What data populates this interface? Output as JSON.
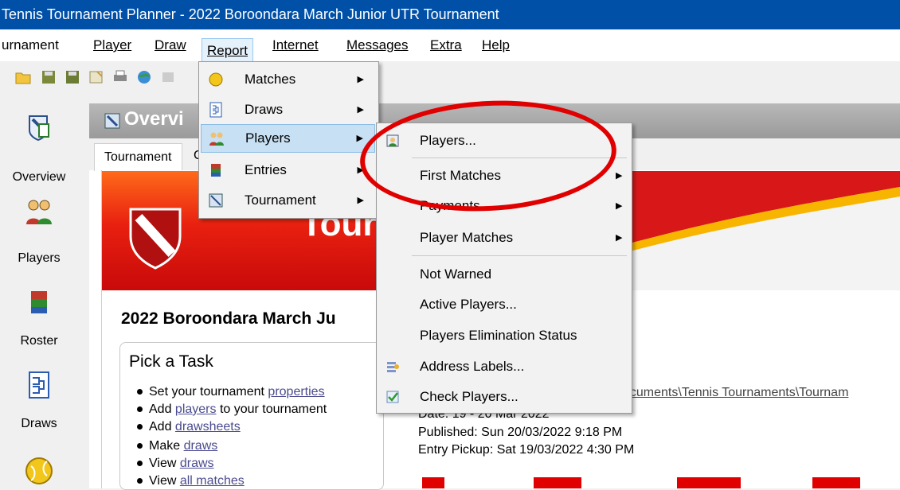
{
  "window": {
    "title": "Tennis Tournament Planner - 2022 Boroondara March Junior UTR Tournament"
  },
  "menubar": {
    "items": [
      "urnament",
      "Player",
      "Draw",
      "Report",
      "Internet",
      "Messages",
      "Extra",
      "Help"
    ]
  },
  "sidebar": {
    "items": [
      {
        "label": "Overview",
        "icon": "overview-icon"
      },
      {
        "label": "Players",
        "icon": "players-icon"
      },
      {
        "label": "Roster",
        "icon": "roster-icon"
      },
      {
        "label": "Draws",
        "icon": "draws-icon"
      }
    ]
  },
  "main": {
    "overview_title": "Overvi",
    "tab_label": "Tournament",
    "tab_cut": "C",
    "banner_text": "Tournamen",
    "heading": "2022 Boroondara March Ju",
    "task_title": "Pick a Task",
    "tasks": [
      {
        "pre": "Set your tournament ",
        "link": "properties",
        "post": ""
      },
      {
        "pre": "Add ",
        "link": "players",
        "post": " to your tournament"
      },
      {
        "pre": "Add ",
        "link": "drawsheets",
        "post": ""
      },
      {
        "pre": "Make ",
        "link": "draws",
        "post": ""
      },
      {
        "pre": "View ",
        "link": "draws",
        "post": ""
      },
      {
        "pre": "View ",
        "link": "all matches",
        "post": ""
      }
    ],
    "path": "ocuments\\Tennis Tournaments\\Tournam",
    "date": "Date: 19 - 20 Mar 2022",
    "published": "Published: Sun 20/03/2022 9:18 PM",
    "entry_pickup": "Entry Pickup: Sat 19/03/2022 4:30 PM"
  },
  "report_menu": {
    "items": [
      {
        "label": "Matches",
        "submenu": true
      },
      {
        "label": "Draws",
        "submenu": true
      },
      {
        "label": "Players",
        "submenu": true,
        "highlighted": true
      },
      {
        "label": "Entries",
        "submenu": true
      },
      {
        "label": "Tournament",
        "submenu": true
      }
    ]
  },
  "players_submenu": {
    "items": [
      {
        "label": "Players...",
        "submenu": false
      },
      {
        "label": "First Matches",
        "submenu": true
      },
      {
        "label": "Payments",
        "submenu": true
      },
      {
        "label": "Player Matches",
        "submenu": true
      },
      {
        "label": "Not Warned",
        "submenu": false
      },
      {
        "label": "Active Players...",
        "submenu": false
      },
      {
        "label": "Players Elimination Status",
        "submenu": false
      },
      {
        "label": "Address Labels...",
        "submenu": false
      },
      {
        "label": "Check Players...",
        "submenu": false
      }
    ]
  },
  "colors": {
    "titlebar": "#0050a8",
    "highlight": "#c7e0f4",
    "annotation": "#e00000",
    "banner": "#e82010"
  }
}
